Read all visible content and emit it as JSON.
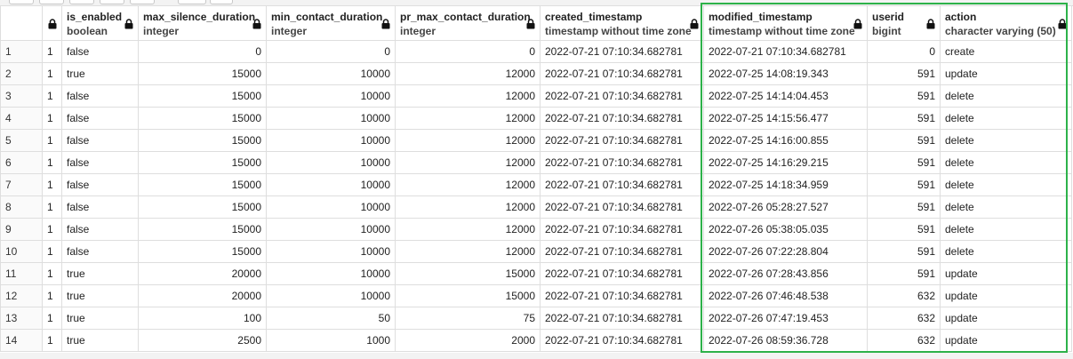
{
  "columns": [
    {
      "name": "",
      "type": ""
    },
    {
      "name": "",
      "type": ""
    },
    {
      "name": "is_enabled",
      "type": "boolean"
    },
    {
      "name": "max_silence_duration",
      "type": "integer"
    },
    {
      "name": "min_contact_duration",
      "type": "integer"
    },
    {
      "name": "pr_max_contact_duration",
      "type": "integer"
    },
    {
      "name": "created_timestamp",
      "type": "timestamp without time zone"
    },
    {
      "name": "modified_timestamp",
      "type": "timestamp without time zone"
    },
    {
      "name": "userid",
      "type": "bigint"
    },
    {
      "name": "action",
      "type": "character varying (50)"
    }
  ],
  "rows": [
    [
      "1",
      "1",
      "false",
      "0",
      "0",
      "0",
      "2022-07-21 07:10:34.682781",
      "2022-07-21 07:10:34.682781",
      "0",
      "create"
    ],
    [
      "2",
      "1",
      "true",
      "15000",
      "10000",
      "12000",
      "2022-07-21 07:10:34.682781",
      "2022-07-25 14:08:19.343",
      "591",
      "update"
    ],
    [
      "3",
      "1",
      "false",
      "15000",
      "10000",
      "12000",
      "2022-07-21 07:10:34.682781",
      "2022-07-25 14:14:04.453",
      "591",
      "delete"
    ],
    [
      "4",
      "1",
      "false",
      "15000",
      "10000",
      "12000",
      "2022-07-21 07:10:34.682781",
      "2022-07-25 14:15:56.477",
      "591",
      "delete"
    ],
    [
      "5",
      "1",
      "false",
      "15000",
      "10000",
      "12000",
      "2022-07-21 07:10:34.682781",
      "2022-07-25 14:16:00.855",
      "591",
      "delete"
    ],
    [
      "6",
      "1",
      "false",
      "15000",
      "10000",
      "12000",
      "2022-07-21 07:10:34.682781",
      "2022-07-25 14:16:29.215",
      "591",
      "delete"
    ],
    [
      "7",
      "1",
      "false",
      "15000",
      "10000",
      "12000",
      "2022-07-21 07:10:34.682781",
      "2022-07-25 14:18:34.959",
      "591",
      "delete"
    ],
    [
      "8",
      "1",
      "false",
      "15000",
      "10000",
      "12000",
      "2022-07-21 07:10:34.682781",
      "2022-07-26 05:28:27.527",
      "591",
      "delete"
    ],
    [
      "9",
      "1",
      "false",
      "15000",
      "10000",
      "12000",
      "2022-07-21 07:10:34.682781",
      "2022-07-26 05:38:05.035",
      "591",
      "delete"
    ],
    [
      "10",
      "1",
      "false",
      "15000",
      "10000",
      "12000",
      "2022-07-21 07:10:34.682781",
      "2022-07-26 07:22:28.804",
      "591",
      "delete"
    ],
    [
      "11",
      "1",
      "true",
      "20000",
      "10000",
      "15000",
      "2022-07-21 07:10:34.682781",
      "2022-07-26 07:28:43.856",
      "591",
      "update"
    ],
    [
      "12",
      "1",
      "true",
      "20000",
      "10000",
      "15000",
      "2022-07-21 07:10:34.682781",
      "2022-07-26 07:46:48.538",
      "632",
      "update"
    ],
    [
      "13",
      "1",
      "true",
      "100",
      "50",
      "75",
      "2022-07-21 07:10:34.682781",
      "2022-07-26 07:47:19.453",
      "632",
      "update"
    ],
    [
      "14",
      "1",
      "true",
      "2500",
      "1000",
      "2000",
      "2022-07-21 07:10:34.682781",
      "2022-07-26 08:59:36.728",
      "632",
      "update"
    ]
  ],
  "highlight_color": "#2db24a",
  "lock_icon": "lock-icon"
}
